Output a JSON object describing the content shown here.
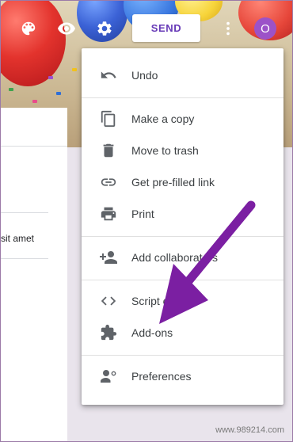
{
  "header": {
    "send_label": "SEND",
    "avatar_initial": "O",
    "toolbar_icons": [
      "palette-icon",
      "eye-icon",
      "gear-icon",
      "more-vert-icon"
    ]
  },
  "form": {
    "snippet_text": "sit amet"
  },
  "menu": {
    "items": [
      {
        "label": "Undo",
        "icon": "undo-icon"
      },
      {
        "label": "Make a copy",
        "icon": "copy-icon"
      },
      {
        "label": "Move to trash",
        "icon": "trash-icon"
      },
      {
        "label": "Get pre-filled link",
        "icon": "link-icon"
      },
      {
        "label": "Print",
        "icon": "print-icon"
      },
      {
        "label": "Add collaborators",
        "icon": "add-people-icon"
      },
      {
        "label": "Script editor",
        "icon": "code-icon"
      },
      {
        "label": "Add-ons",
        "icon": "puzzle-icon"
      },
      {
        "label": "Preferences",
        "icon": "person-settings-icon"
      }
    ]
  },
  "annotation": {
    "arrow_color": "#7b1fa2"
  },
  "watermark": "www.989214.com"
}
